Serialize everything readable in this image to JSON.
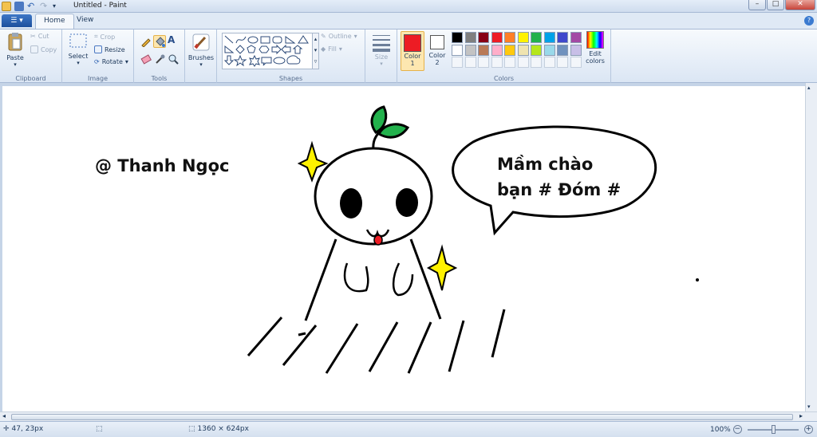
{
  "window": {
    "title": "Untitled - Paint",
    "minimize": "–",
    "maximize": "□",
    "close": "✕"
  },
  "tabs": [
    {
      "label": "Home"
    },
    {
      "label": "View"
    }
  ],
  "help": "?",
  "clipboard": {
    "paste": "Paste",
    "cut": "Cut",
    "copy": "Copy",
    "group": "Clipboard"
  },
  "image": {
    "select": "Select",
    "crop": "Crop",
    "resize": "Resize",
    "rotate": "Rotate",
    "group": "Image"
  },
  "tools": {
    "group": "Tools"
  },
  "brushes": {
    "label": "Brushes"
  },
  "shapes": {
    "outline": "Outline",
    "fill": "Fill",
    "group": "Shapes"
  },
  "size": {
    "label": "Size"
  },
  "colors": {
    "color1_label": "Color",
    "color1_num": "1",
    "color2_label": "Color",
    "color2_num": "2",
    "edit": "Edit",
    "edit2": "colors",
    "group": "Colors",
    "color1": "#ed1c24",
    "color2": "#ffffff",
    "palette_row1": [
      "#000000",
      "#7f7f7f",
      "#880015",
      "#ed1c24",
      "#ff7f27",
      "#fff200",
      "#22b14c",
      "#00a2e8",
      "#3f48cc",
      "#a349a4"
    ],
    "palette_row2": [
      "#ffffff",
      "#c3c3c3",
      "#b97a57",
      "#ffaec9",
      "#ffc90e",
      "#efe4b0",
      "#b5e61d",
      "#99d9ea",
      "#7092be",
      "#c8bfe7"
    ]
  },
  "drawing": {
    "signature": "@ Thanh Ngọc",
    "bubble_line1": "Mầm chào",
    "bubble_line2": "bạn # Đóm #"
  },
  "status": {
    "position": "47, 23px",
    "dimensions": "1360 × 624px",
    "zoom": "100%"
  }
}
